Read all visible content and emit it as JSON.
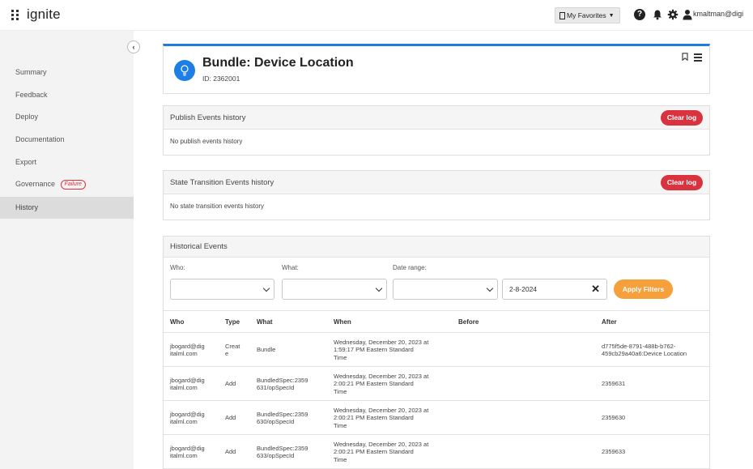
{
  "app": {
    "name": "ignite"
  },
  "topbar": {
    "favorites_label": "My Favorites",
    "user_name": "kmaltman@digi"
  },
  "sidebar": {
    "items": [
      {
        "label": "Summary"
      },
      {
        "label": "Feedback"
      },
      {
        "label": "Deploy"
      },
      {
        "label": "Documentation"
      },
      {
        "label": "Export"
      },
      {
        "label": "Governance",
        "badge": "Failure"
      },
      {
        "label": "History",
        "active": true
      }
    ]
  },
  "header": {
    "title": "Bundle: Device Location",
    "id_text": "ID: 2362001"
  },
  "publish": {
    "title": "Publish Events history",
    "clear_label": "Clear log",
    "empty_text": "No publish events history"
  },
  "state": {
    "title": "State Transition Events history",
    "clear_label": "Clear log",
    "empty_text": "No state transition events history"
  },
  "history": {
    "title": "Historical Events",
    "filters": {
      "who_label": "Who:",
      "what_label": "What:",
      "date_label": "Date range:",
      "date_value": "2-8-2024",
      "apply_label": "Apply Filters"
    },
    "columns": [
      "Who",
      "Type",
      "What",
      "When",
      "Before",
      "After"
    ],
    "rows": [
      {
        "who": [
          "jbogard@dig",
          "italml.com"
        ],
        "type": [
          "Creat",
          "e"
        ],
        "what": [
          "Bundle"
        ],
        "when": [
          "Wednesday, December 20, 2023 at",
          "1:59:17 PM Eastern Standard",
          "Time"
        ],
        "before": "",
        "after": [
          "d775f5de-8791-488b-b762-",
          "459cb29a40a6:Device Location"
        ]
      },
      {
        "who": [
          "jbogard@dig",
          "italml.com"
        ],
        "type": [
          "Add"
        ],
        "what": [
          "BundledSpec:2359",
          "631/opSpecId"
        ],
        "when": [
          "Wednesday, December 20, 2023 at",
          "2:00:21 PM Eastern Standard",
          "Time"
        ],
        "before": "",
        "after": [
          "2359631"
        ]
      },
      {
        "who": [
          "jbogard@dig",
          "italml.com"
        ],
        "type": [
          "Add"
        ],
        "what": [
          "BundledSpec:2359",
          "630/opSpecId"
        ],
        "when": [
          "Wednesday, December 20, 2023 at",
          "2:00:21 PM Eastern Standard",
          "Time"
        ],
        "before": "",
        "after": [
          "2359630"
        ]
      },
      {
        "who": [
          "jbogard@dig",
          "italml.com"
        ],
        "type": [
          "Add"
        ],
        "what": [
          "BundledSpec:2359",
          "633/opSpecId"
        ],
        "when": [
          "Wednesday, December 20, 2023 at",
          "2:00:21 PM Eastern Standard",
          "Time"
        ],
        "before": "",
        "after": [
          "2359633"
        ]
      }
    ]
  },
  "colors": {
    "accent_blue": "#1e7be0",
    "danger_red": "#d9333f",
    "apply_orange": "#f6a03c",
    "sidebar_bg": "#f3f3f3"
  }
}
